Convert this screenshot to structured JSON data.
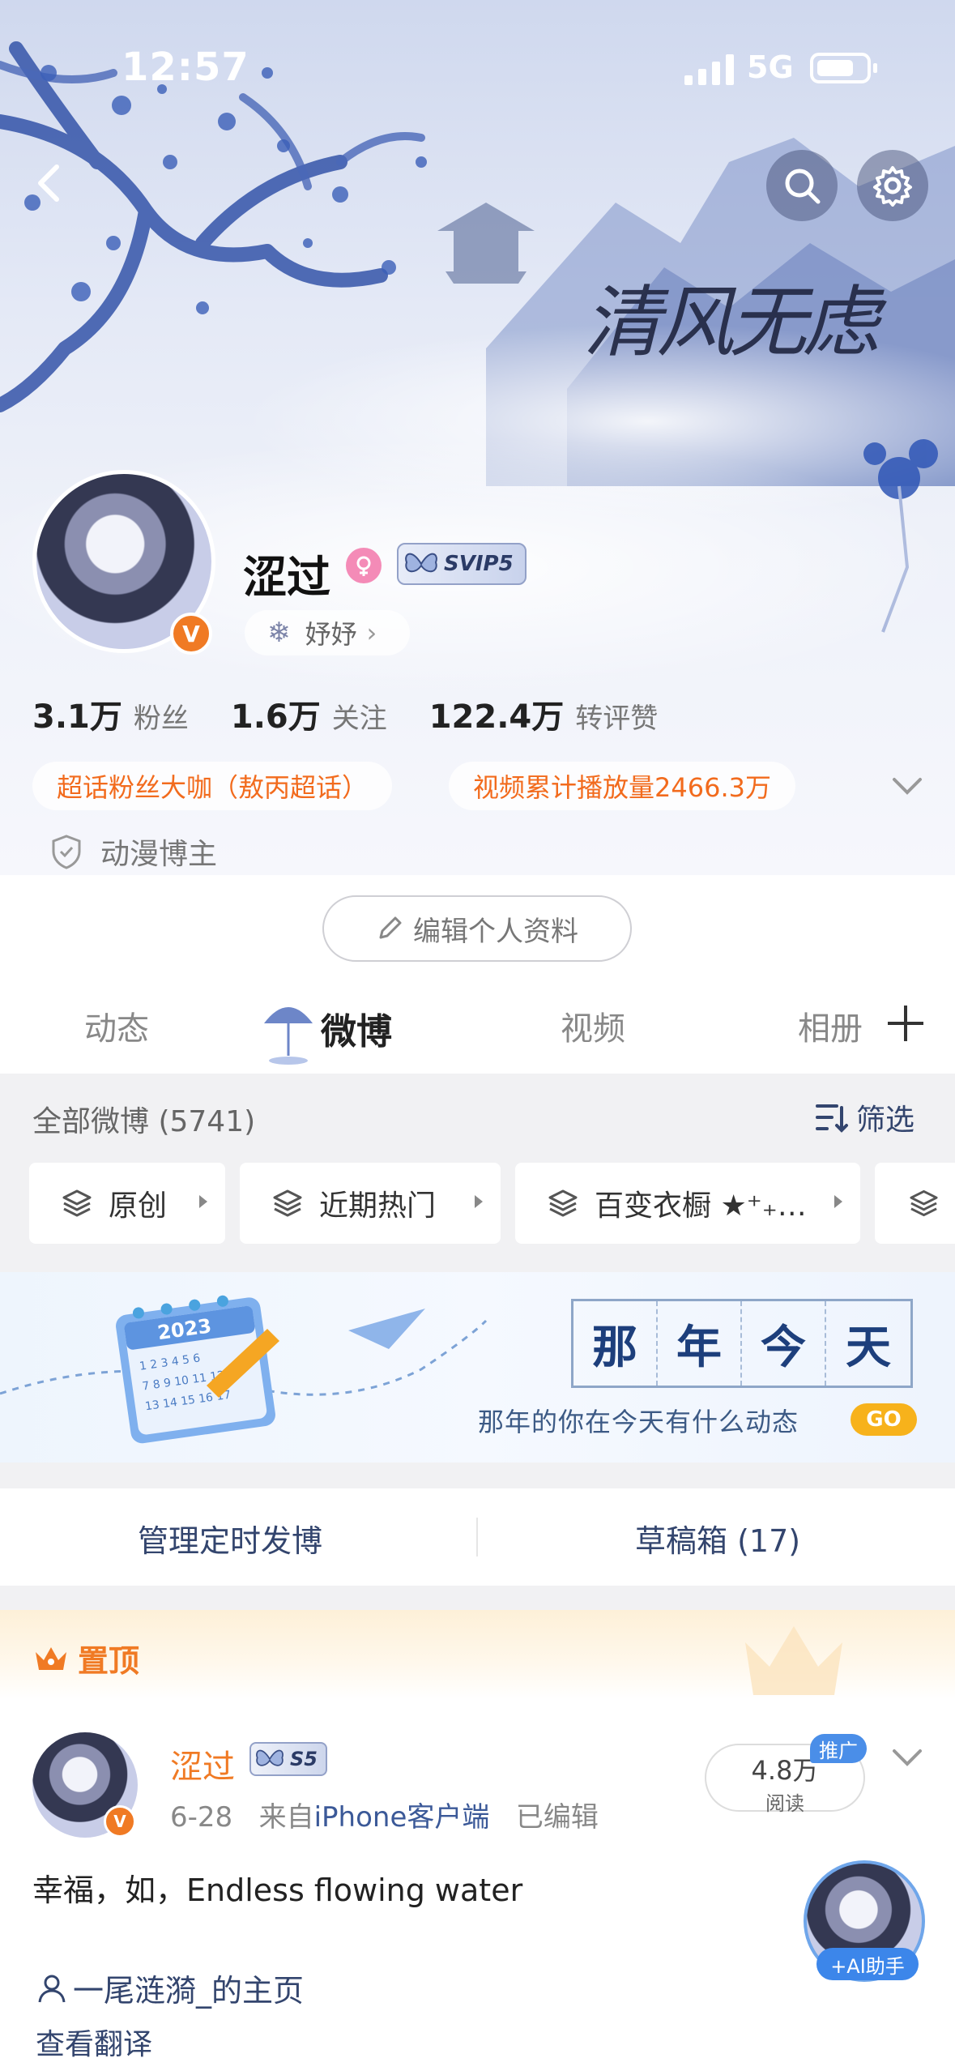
{
  "status_bar": {
    "time": "12:57",
    "network": "5G"
  },
  "banner": {
    "calligraphy": "清风无虑"
  },
  "profile": {
    "name": "涩过",
    "vip_badge": "SVIP5",
    "nickname": "妤妤",
    "stats": [
      {
        "value": "3.1万",
        "label": "粉丝"
      },
      {
        "value": "1.6万",
        "label": "关注"
      },
      {
        "value": "122.4万",
        "label": "转评赞"
      }
    ],
    "tags": [
      "超话粉丝大咖（敖丙超话）",
      "视频累计播放量2466.3万"
    ],
    "creator_label": "动漫博主",
    "edit_button": "编辑个人资料"
  },
  "tabs": [
    {
      "label": "动态"
    },
    {
      "label": "微博"
    },
    {
      "label": "视频"
    },
    {
      "label": "相册"
    }
  ],
  "filter": {
    "all_label": "全部微博 (5741)",
    "screen_label": "筛选",
    "chips": [
      "原创",
      "近期热门",
      "百变衣橱 ★⁺₊…"
    ]
  },
  "memory": {
    "title_chars": [
      "那",
      "年",
      "今",
      "天"
    ],
    "subtitle": "那年的你在今天有什么动态",
    "go": "GO",
    "calendar_year": "2023"
  },
  "schedule": {
    "left": "管理定时发博",
    "right": "草稿箱 (17)"
  },
  "pinned_label": "置顶",
  "post": {
    "author": "涩过",
    "level_badge": "S5",
    "date": "6-28",
    "source_prefix": "来自",
    "source": "iPhone客户端",
    "edited": "已编辑",
    "reads_value": "4.8万",
    "reads_label": "阅读",
    "promo": "推广",
    "text": "幸福，如，Endless flowing water",
    "home_link": "一尾涟漪_的主页",
    "translate": "查看翻译",
    "ai_label": "+AI助手"
  },
  "colors": {
    "accent": "#f07a24",
    "link": "#33456e",
    "blue": "#3c86ea"
  }
}
